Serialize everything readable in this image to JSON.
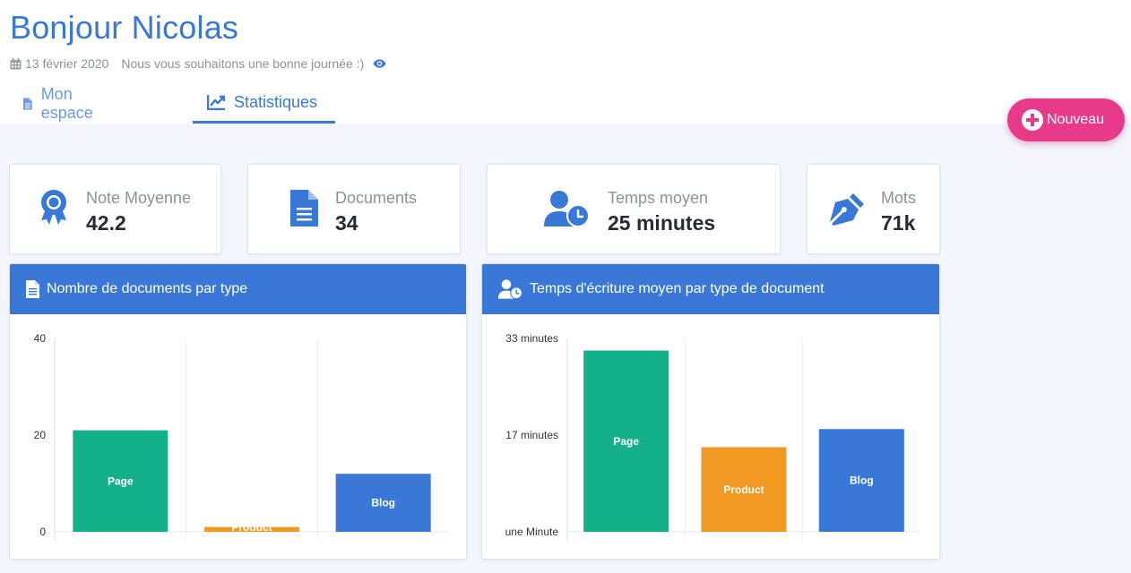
{
  "header": {
    "greeting": "Bonjour Nicolas",
    "date": "13 février 2020",
    "message": "Nous vous souhaitons une bonne journée :)"
  },
  "tabs": [
    {
      "label": "Mon espace",
      "icon": "document-icon",
      "active": false
    },
    {
      "label": "Statistiques",
      "icon": "chart-line-icon",
      "active": true
    }
  ],
  "new_button": {
    "label": "Nouveau",
    "color": "#e83a8a"
  },
  "stats": [
    {
      "label": "Note Moyenne",
      "value": "42.2",
      "icon": "award-icon"
    },
    {
      "label": "Documents",
      "value": "34",
      "icon": "file-icon"
    },
    {
      "label": "Temps moyen",
      "value": "25 minutes",
      "icon": "user-clock-icon"
    },
    {
      "label": "Mots",
      "value": "71k",
      "icon": "pen-nib-icon"
    }
  ],
  "panels": [
    {
      "title": "Nombre de documents par type",
      "icon": "file-icon"
    },
    {
      "title": "Temps d'écriture moyen par type de document",
      "icon": "user-clock-icon"
    }
  ],
  "colors": {
    "accent": "#3a78d8",
    "page": "#14b08a",
    "product": "#f09a23",
    "blog": "#3a78d8"
  },
  "chart_data": [
    {
      "type": "bar",
      "categories": [
        "Page",
        "Product",
        "Blog"
      ],
      "values": [
        21,
        1,
        12
      ],
      "ylim": [
        0,
        40
      ],
      "yticks": [
        {
          "value": 0,
          "label": "0"
        },
        {
          "value": 20,
          "label": "20"
        },
        {
          "value": 40,
          "label": "40"
        }
      ],
      "grid": true,
      "colors": [
        "#14b08a",
        "#f09a23",
        "#3a78d8"
      ]
    },
    {
      "type": "bar",
      "categories": [
        "Page",
        "Product",
        "Blog"
      ],
      "values": [
        31,
        15,
        18
      ],
      "ylim": [
        1,
        33
      ],
      "yticks": [
        {
          "value": 1,
          "label": "une Minute"
        },
        {
          "value": 17,
          "label": "17 minutes"
        },
        {
          "value": 33,
          "label": "33 minutes"
        }
      ],
      "grid": true,
      "colors": [
        "#14b08a",
        "#f09a23",
        "#3a78d8"
      ]
    }
  ]
}
